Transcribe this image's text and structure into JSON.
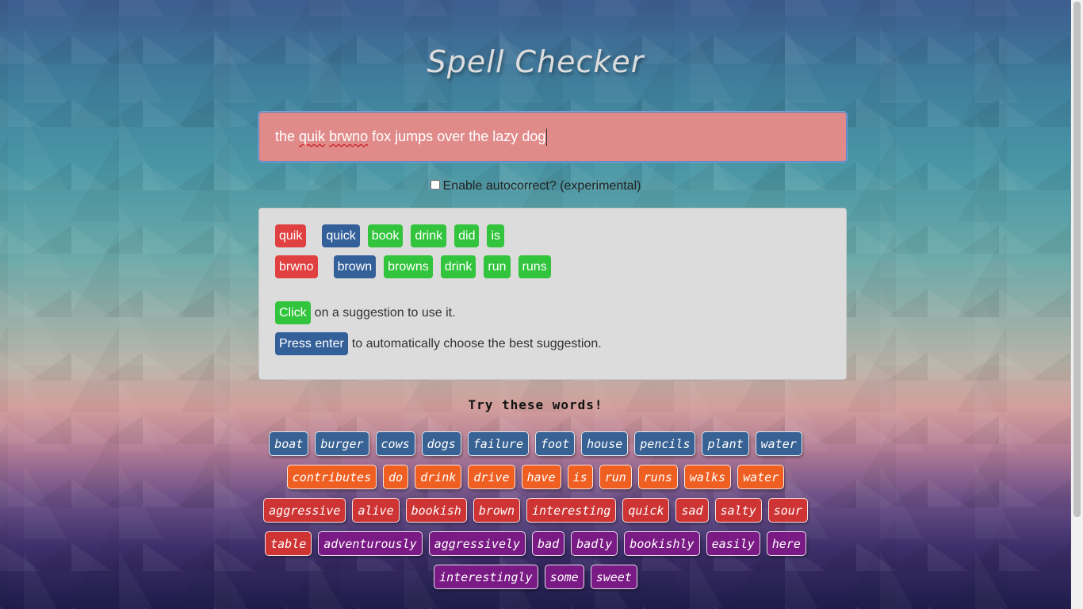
{
  "title": "Spell Checker",
  "input": {
    "words": [
      {
        "text": "the",
        "misspelled": false
      },
      {
        "text": "quik",
        "misspelled": true
      },
      {
        "text": "brwno",
        "misspelled": true
      },
      {
        "text": "fox",
        "misspelled": false
      },
      {
        "text": "jumps",
        "misspelled": false
      },
      {
        "text": "over",
        "misspelled": false
      },
      {
        "text": "the",
        "misspelled": false
      },
      {
        "text": "lazy",
        "misspelled": false
      },
      {
        "text": "dog",
        "misspelled": false
      }
    ]
  },
  "autocorrect": {
    "label": "Enable autocorrect? (experimental)",
    "checked": false
  },
  "suggestions": [
    {
      "word": "quik",
      "best": "quick",
      "others": [
        "book",
        "drink",
        "did",
        "is"
      ]
    },
    {
      "word": "brwno",
      "best": "brown",
      "others": [
        "browns",
        "drink",
        "run",
        "runs"
      ]
    }
  ],
  "help": {
    "click_chip": "Click",
    "click_text": "on a suggestion to use it.",
    "enter_chip": "Press enter",
    "enter_text": "to automatically choose the best suggestion."
  },
  "try_title": "Try these words!",
  "word_rows": [
    [
      {
        "t": "boat",
        "c": "blue"
      },
      {
        "t": "burger",
        "c": "blue"
      },
      {
        "t": "cows",
        "c": "blue"
      },
      {
        "t": "dogs",
        "c": "blue"
      },
      {
        "t": "failure",
        "c": "blue"
      },
      {
        "t": "foot",
        "c": "blue"
      },
      {
        "t": "house",
        "c": "blue"
      },
      {
        "t": "pencils",
        "c": "blue"
      },
      {
        "t": "plant",
        "c": "blue"
      },
      {
        "t": "water",
        "c": "blue"
      }
    ],
    [
      {
        "t": "contributes",
        "c": "orange"
      },
      {
        "t": "do",
        "c": "orange"
      },
      {
        "t": "drink",
        "c": "orange"
      },
      {
        "t": "drive",
        "c": "orange"
      },
      {
        "t": "have",
        "c": "orange"
      },
      {
        "t": "is",
        "c": "orange"
      },
      {
        "t": "run",
        "c": "orange"
      },
      {
        "t": "runs",
        "c": "orange"
      },
      {
        "t": "walks",
        "c": "orange"
      },
      {
        "t": "water",
        "c": "orange"
      }
    ],
    [
      {
        "t": "aggressive",
        "c": "red"
      },
      {
        "t": "alive",
        "c": "red"
      },
      {
        "t": "bookish",
        "c": "red"
      },
      {
        "t": "brown",
        "c": "red"
      },
      {
        "t": "interesting",
        "c": "red"
      },
      {
        "t": "quick",
        "c": "red"
      },
      {
        "t": "sad",
        "c": "red"
      },
      {
        "t": "salty",
        "c": "red"
      },
      {
        "t": "sour",
        "c": "red"
      }
    ],
    [
      {
        "t": "table",
        "c": "red"
      },
      {
        "t": "adventurously",
        "c": "purple"
      },
      {
        "t": "aggressively",
        "c": "purple"
      },
      {
        "t": "bad",
        "c": "purple"
      },
      {
        "t": "badly",
        "c": "purple"
      },
      {
        "t": "bookishly",
        "c": "purple"
      },
      {
        "t": "easily",
        "c": "purple"
      },
      {
        "t": "here",
        "c": "purple"
      }
    ],
    [
      {
        "t": "interestingly",
        "c": "purple"
      },
      {
        "t": "some",
        "c": "purple"
      },
      {
        "t": "sweet",
        "c": "purple"
      }
    ]
  ],
  "colors": {
    "blue": "#386294",
    "orange": "#f05f22",
    "red": "#cf3434",
    "purple": "#7a1a85",
    "suggestion_green": "#32c43c",
    "suggestion_blue": "#34609a",
    "misspelled_red": "#e04040"
  }
}
